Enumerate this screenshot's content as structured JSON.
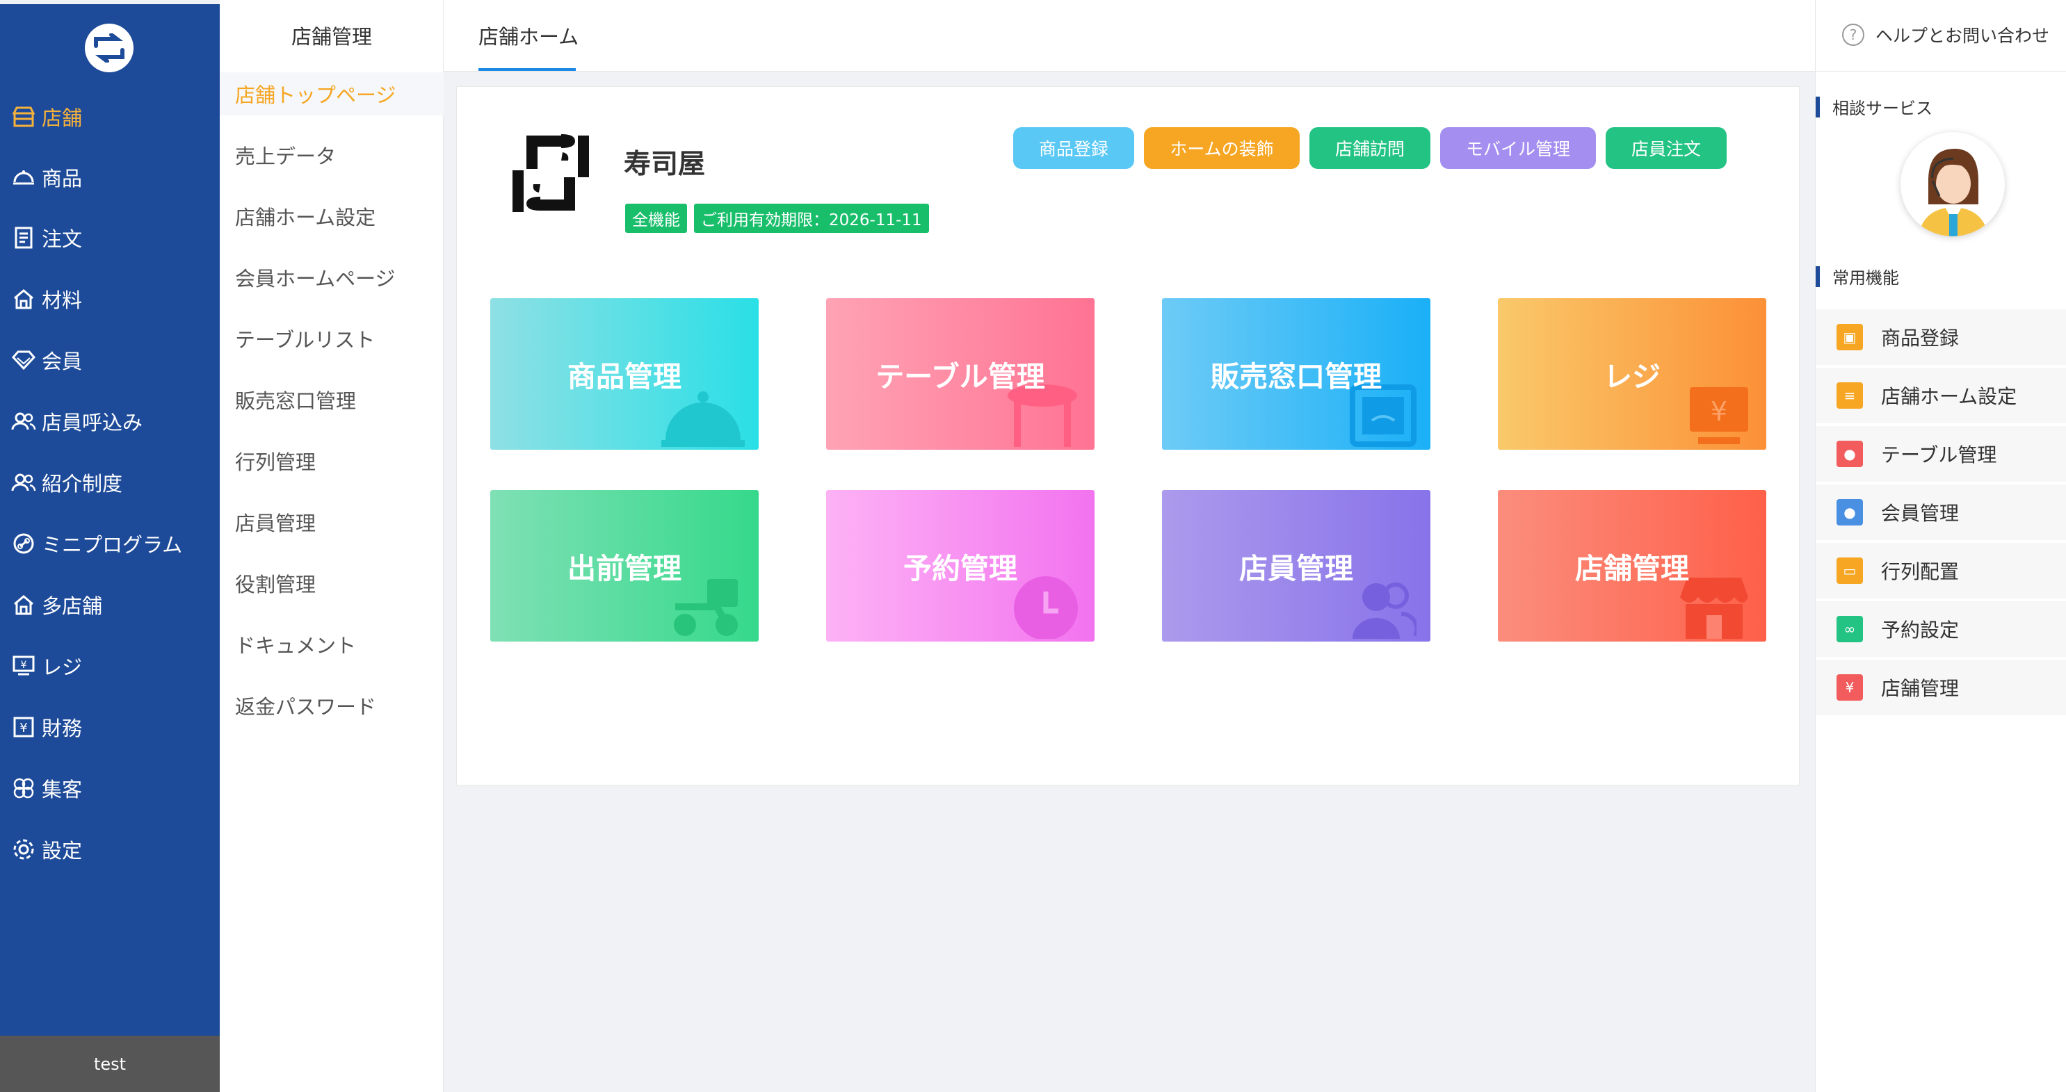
{
  "sidebar": {
    "items": [
      {
        "label": "店舗",
        "icon": "store-icon",
        "active": true
      },
      {
        "label": "商品",
        "icon": "cloche-icon",
        "active": false
      },
      {
        "label": "注文",
        "icon": "document-icon",
        "active": false
      },
      {
        "label": "材料",
        "icon": "house-icon",
        "active": false
      },
      {
        "label": "会員",
        "icon": "diamond-icon",
        "active": false
      },
      {
        "label": "店員呼込み",
        "icon": "users-icon",
        "active": false
      },
      {
        "label": "紹介制度",
        "icon": "users-icon",
        "active": false
      },
      {
        "label": "ミニプログラム",
        "icon": "link-icon",
        "active": false
      },
      {
        "label": "多店舗",
        "icon": "house-icon",
        "active": false
      },
      {
        "label": "レジ",
        "icon": "register-icon",
        "active": false
      },
      {
        "label": "財務",
        "icon": "yen-icon",
        "active": false
      },
      {
        "label": "集客",
        "icon": "clover-icon",
        "active": false
      },
      {
        "label": "設定",
        "icon": "gear-icon",
        "active": false
      }
    ],
    "user": "test"
  },
  "submenu": {
    "title": "店舗管理",
    "items": [
      {
        "label": "店舗トップページ",
        "active": true
      },
      {
        "label": "売上データ",
        "active": false
      },
      {
        "label": "店舗ホーム設定",
        "active": false
      },
      {
        "label": "会員ホームページ",
        "active": false
      },
      {
        "label": "テーブルリスト",
        "active": false
      },
      {
        "label": "販売窓口管理",
        "active": false
      },
      {
        "label": "行列管理",
        "active": false
      },
      {
        "label": "店員管理",
        "active": false
      },
      {
        "label": "役割管理",
        "active": false
      },
      {
        "label": "ドキュメント",
        "active": false
      },
      {
        "label": "返金パスワード",
        "active": false
      }
    ]
  },
  "header": {
    "tab": "店舗ホーム"
  },
  "store": {
    "name": "寿司屋",
    "badge_plan": "全機能",
    "badge_expiry": "ご利用有効期限：2026-11-11"
  },
  "actions": [
    {
      "label": "商品登録",
      "color": "#5ac8f5"
    },
    {
      "label": "ホームの装飾",
      "color": "#f6a623"
    },
    {
      "label": "店舗訪問",
      "color": "#23c384"
    },
    {
      "label": "モバイル管理",
      "color": "#a48ff0"
    },
    {
      "label": "店員注文",
      "color": "#23c384"
    }
  ],
  "tiles": [
    {
      "label": "商品管理",
      "icon": "cloche-icon",
      "from": "#8ee0e4",
      "to": "#2adfe6"
    },
    {
      "label": "テーブル管理",
      "icon": "table-icon",
      "from": "#ffa3b4",
      "to": "#ff7393"
    },
    {
      "label": "販売窓口管理",
      "icon": "counter-icon",
      "from": "#6dcbf6",
      "to": "#1ab0f7"
    },
    {
      "label": "レジ",
      "icon": "register-icon",
      "from": "#f9c96a",
      "to": "#fc9037"
    },
    {
      "label": "出前管理",
      "icon": "scooter-icon",
      "from": "#7fe0b5",
      "to": "#35d98b"
    },
    {
      "label": "予約管理",
      "icon": "clock-icon",
      "from": "#fdb2f5",
      "to": "#f273ef"
    },
    {
      "label": "店員管理",
      "icon": "staff-icon",
      "from": "#ac9aec",
      "to": "#8873ea"
    },
    {
      "label": "店舗管理",
      "icon": "shop-icon",
      "from": "#fb8d7d",
      "to": "#fe6049"
    }
  ],
  "rightpanel": {
    "help": "ヘルプとお問い合わせ",
    "consult_title": "相談サービス",
    "common_title": "常用機能",
    "quick": [
      {
        "label": "商品登録",
        "color": "#f6a623",
        "icon": "bag-icon"
      },
      {
        "label": "店舗ホーム設定",
        "color": "#f6a623",
        "icon": "clipboard-icon"
      },
      {
        "label": "テーブル管理",
        "color": "#f25c5c",
        "icon": "pot-icon"
      },
      {
        "label": "会員管理",
        "color": "#4a90e2",
        "icon": "member-icon"
      },
      {
        "label": "行列配置",
        "color": "#f6a623",
        "icon": "queue-icon"
      },
      {
        "label": "予約設定",
        "color": "#23c384",
        "icon": "link-icon"
      },
      {
        "label": "店舗管理",
        "color": "#f25c5c",
        "icon": "shop-icon"
      }
    ]
  }
}
